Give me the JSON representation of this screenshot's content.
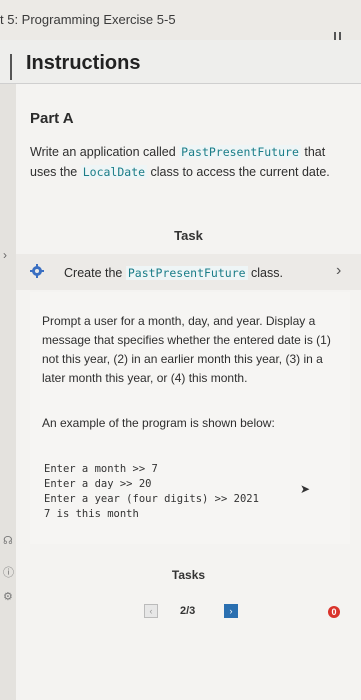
{
  "header": {
    "breadcrumb": "t 5: Programming Exercise 5-5",
    "menu_icon": "hamburger-menu-icon"
  },
  "instructions": {
    "title": "Instructions"
  },
  "part": {
    "title": "Part A",
    "intro_1": "Write an application called ",
    "class_name": "PastPresentFuture",
    "intro_2": " that uses the ",
    "date_class": "LocalDate",
    "intro_3": " class to access the current date."
  },
  "task": {
    "heading": "Task",
    "row_prefix": "Create the ",
    "row_code": "PastPresentFuture",
    "row_suffix": " class.",
    "prompt": "Prompt a user for a month, day, and year. Display a message that specifies whether the entered date is (1) not this year, (2) in an earlier month this year, (3) in a later month this year, or (4) this month.",
    "example_label": "An example of the program is shown below:",
    "console_lines": [
      "Enter a month >> 7",
      "Enter a day >> 20",
      "Enter a year (four digits) >> 2021",
      "7 is this month"
    ]
  },
  "footer": {
    "tasks_label": "Tasks",
    "pager": "2/3",
    "alert_count": "0"
  }
}
